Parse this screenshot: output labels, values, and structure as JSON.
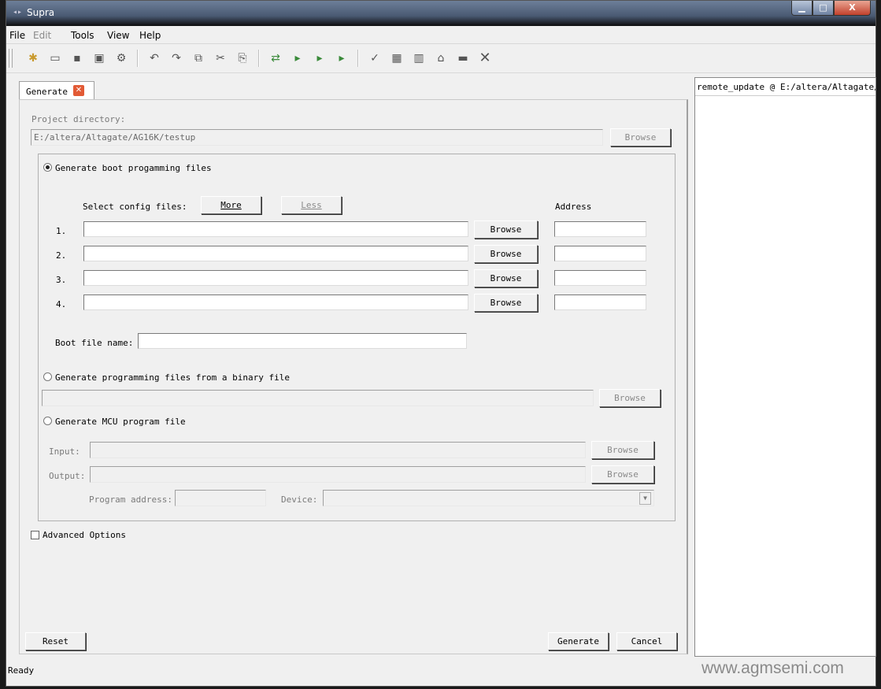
{
  "window": {
    "title": "Supra",
    "min": "▁",
    "max": "□",
    "close": "X"
  },
  "menu": [
    "File",
    "Edit",
    "Tools",
    "View",
    "Help"
  ],
  "toolbar": [
    "new-file-icon",
    "open-icon",
    "save-icon",
    "save-as-icon",
    "settings-icon",
    "undo-icon",
    "redo-icon",
    "copy-icon",
    "cut-icon",
    "paste-icon",
    "compile-icon",
    "run-r-icon",
    "run-p-icon",
    "run-c-icon",
    "check-icon",
    "chip-icon",
    "memory-icon",
    "programmer-icon",
    "device-icon",
    "close-icon"
  ],
  "tab": {
    "label": "Generate"
  },
  "project": {
    "label": "Project directory:",
    "path": "E:/altera/Altagate/AG16K/testup",
    "browse": "Browse"
  },
  "boot": {
    "radio_label": "Generate boot progamming files",
    "select_label": "Select config files:",
    "more": "More",
    "less": "Less",
    "address_label": "Address",
    "rows": [
      {
        "num": "1.",
        "browse": "Browse"
      },
      {
        "num": "2.",
        "browse": "Browse"
      },
      {
        "num": "3.",
        "browse": "Browse"
      },
      {
        "num": "4.",
        "browse": "Browse"
      }
    ],
    "boot_file_label": "Boot file name:"
  },
  "binary": {
    "radio_label": "Generate programming files from a binary file",
    "browse": "Browse"
  },
  "mcu": {
    "radio_label": "Generate MCU program file",
    "input_label": "Input:",
    "output_label": "Output:",
    "browse": "Browse",
    "program_address_label": "Program address:",
    "device_label": "Device:"
  },
  "advanced": {
    "label": "Advanced Options"
  },
  "footer": {
    "reset": "Reset",
    "generate": "Generate",
    "cancel": "Cancel"
  },
  "sidebar": {
    "header": "remote_update @ E:/altera/Altagate/"
  },
  "status": {
    "text": "Ready"
  },
  "watermark": "www.agmsemi.com"
}
